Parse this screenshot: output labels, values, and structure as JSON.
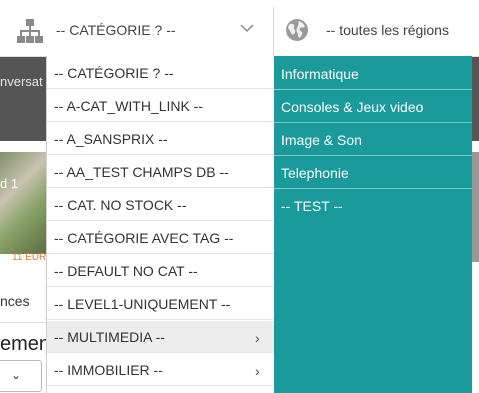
{
  "background": {
    "band_text": "nversat",
    "photo_label": "d 1",
    "price": "11 EUR",
    "tab": "nces",
    "heading": "emen"
  },
  "category_select": {
    "label": "-- CATÉGORIE ? --",
    "icon": "sitemap-icon"
  },
  "region_select": {
    "label": "-- toutes les régions",
    "icon": "globe-icon"
  },
  "dropdown": {
    "items": [
      {
        "label": "-- CATÉGORIE ? --"
      },
      {
        "label": "-- A-CAT_WITH_LINK --"
      },
      {
        "label": "-- A_SANSPRIX --"
      },
      {
        "label": "-- AA_TEST CHAMPS DB --"
      },
      {
        "label": "-- CAT. NO STOCK --"
      },
      {
        "label": "-- CATÉGORIE AVEC TAG --"
      },
      {
        "label": "-- DEFAULT NO CAT --"
      },
      {
        "label": "-- LEVEL1-UNIQUEMENT --"
      },
      {
        "label": "-- MULTIMEDIA --",
        "arrow": "›"
      },
      {
        "label": "-- IMMOBILIER --",
        "arrow": "›"
      }
    ]
  },
  "submenu": {
    "items": [
      {
        "label": "Informatique"
      },
      {
        "label": "Consoles & Jeux video"
      },
      {
        "label": "Image & Son"
      },
      {
        "label": "Telephonie"
      },
      {
        "label": "-- TEST --"
      }
    ]
  },
  "colors": {
    "submenu_bg": "#1a9a9a",
    "active_item_bg": "#ededed"
  }
}
